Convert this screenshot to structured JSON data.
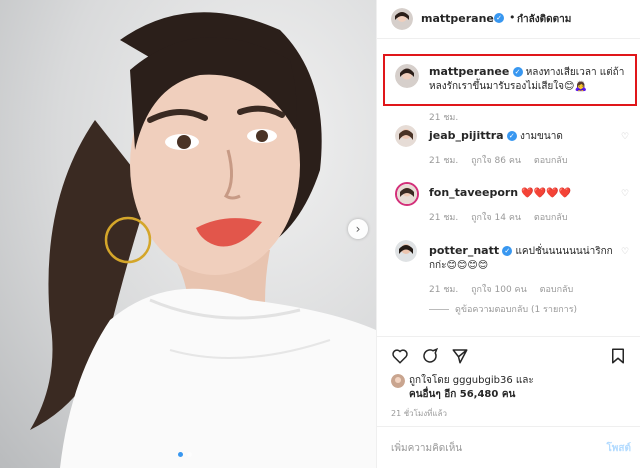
{
  "post": {
    "author": "mattperanee",
    "follow_separator": "•",
    "follow_label": "กำลังติดตาม",
    "image_dots": 2,
    "active_dot": 0
  },
  "caption": {
    "author": "mattperanee",
    "text": "หลงทางเสียเวลา แต่ถ้าหลงรักเราขึ้นมารับรองไม่เสียใจ😊🙇‍♀️",
    "time": "21 ชม."
  },
  "comments": [
    {
      "user": "jeab_pijittra",
      "verified": false,
      "text": "งามขนาด",
      "time": "21 ชม.",
      "likes": "ถูกใจ 86 คน",
      "reply": "ตอบกลับ",
      "text_color": "#262626"
    },
    {
      "user": "fon_taveeporn",
      "verified": false,
      "text": "❤️❤️❤️❤️",
      "time": "21 ชม.",
      "likes": "ถูกใจ 14 คน",
      "reply": "ตอบกลับ",
      "text_color": "#e0161a"
    },
    {
      "user": "potter_natt",
      "verified": true,
      "text": "แคปชั่นนนนนนน่าริกกกก่ะ😊😊😊😊",
      "time": "21 ชม.",
      "likes": "ถูกใจ 100 คน",
      "reply": "ตอบกลับ"
    }
  ],
  "view_replies": "ดูข้อความตอบกลับ (1 รายการ)",
  "likes_line1": "ถูกใจโดย gggubgib36 และ",
  "likes_line2": "คนอื่นๆ อีก 56,480 คน",
  "posted_ago": "21 ชั่วโมงที่แล้ว",
  "add_comment_placeholder": "เพิ่มความคิดเห็น",
  "post_button": "โพสต์",
  "colors": {
    "verified": "#3897f0",
    "highlight": "#e0161a",
    "post_disabled": "#b3dbff"
  }
}
